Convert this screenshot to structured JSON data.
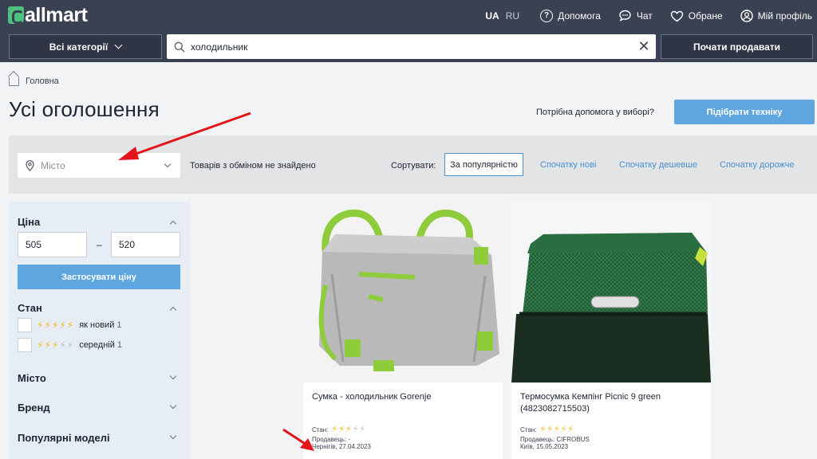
{
  "brand": {
    "logo": "allmart"
  },
  "header": {
    "lang_active": "UA",
    "lang_other": "RU",
    "links": [
      "Допомога",
      "Чат",
      "Обране",
      "Мій профіль"
    ],
    "categories_label": "Всі категорії",
    "search_value": "холодильник",
    "sell_label": "Почати продавати"
  },
  "breadcrumb": {
    "home": "Головна"
  },
  "page": {
    "title": "Усі оголошення",
    "help_question": "Потрібна допомога у виборі?",
    "pick_button": "Підібрати техніку"
  },
  "filterbar": {
    "city_placeholder": "Місто",
    "no_exchange": "Товарів з обміном не знайдено",
    "sort_label": "Сортувати:",
    "sort_options": [
      "За популярністю",
      "Спочатку нові",
      "Спочатку дешевше",
      "Спочатку дорожче"
    ],
    "sort_active_index": 0
  },
  "sidebar": {
    "price_title": "Ціна",
    "price_from": "505",
    "price_dash": "–",
    "price_to": "520",
    "apply_label": "Застосувати ціну",
    "condition_title": "Стан",
    "conditions": [
      {
        "label": "як новий",
        "count": "1",
        "stars": 5
      },
      {
        "label": "середній",
        "count": "1",
        "stars": 3
      }
    ],
    "sections": [
      "Місто",
      "Бренд",
      "Популярні моделі"
    ]
  },
  "cards": [
    {
      "title": "Сумка - холодильник Gorenje",
      "condition_label": "Стан:",
      "stars": 3,
      "seller": "Продавець: -",
      "location_date": "Чернігів, 27.04.2023"
    },
    {
      "title": "Термосумка Кемпінг Picnic 9 green (4823082715503)",
      "condition_label": "Стан:",
      "stars": 5,
      "seller": "Продавець: CIFROBUS",
      "location_date": "Київ, 15.05.2023"
    }
  ],
  "colors": {
    "header_bg": "#3a4152",
    "accent_blue": "#5fa6e0",
    "link_blue": "#4a8fd0",
    "logo_green": "#4ec17f",
    "bolt_yellow": "#f5b913",
    "annotation_red": "#e3151b"
  },
  "icons": [
    "help-icon",
    "chat-icon",
    "heart-icon",
    "profile-icon",
    "search-icon",
    "close-icon",
    "location-pin-icon",
    "home-icon",
    "lightning-icon"
  ]
}
